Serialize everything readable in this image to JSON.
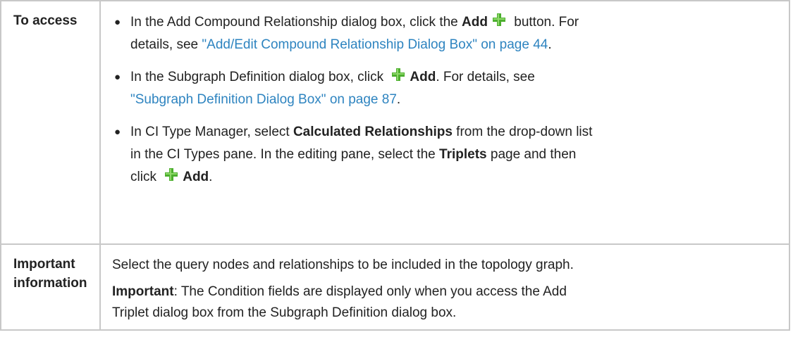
{
  "table": {
    "row1": {
      "header": "To access",
      "items": [
        {
          "line1_pre": "In the Add Compound Relationship dialog box, click the ",
          "line1_bold": "Add",
          "line1_post": " button. For",
          "line2_pre": "details, see ",
          "line2_link": "\"Add/Edit Compound Relationship Dialog Box\" on page 44",
          "line2_post": "."
        },
        {
          "line1_pre": "In the Subgraph Definition dialog box, click ",
          "line1_bold": "Add",
          "line1_post": ". For details, see",
          "line2_link": "\"Subgraph Definition Dialog Box\" on page 87",
          "line2_post": "."
        },
        {
          "line1_pre": "In CI Type Manager, select ",
          "line1_bold": "Calculated Relationships",
          "line1_post": " from the drop-down list",
          "line2_pre": "in the CI Types pane. In the editing pane, select the ",
          "line2_bold": "Triplets",
          "line2_post": " page and then",
          "line3_pre": "click ",
          "line3_bold": "Add",
          "line3_post": "."
        }
      ]
    },
    "row2": {
      "header_line1": "Important",
      "header_line2": "information",
      "p1": "Select the query nodes and relationships to be included in the topology graph.",
      "p2_bold": "Important",
      "p2_line1": ": The Condition fields are displayed only when you access the Add",
      "p2_line2": "Triplet dialog box from the Subgraph Definition dialog box."
    }
  },
  "colors": {
    "link": "#2e84c0",
    "border": "#c8c8c8",
    "icon_green": "#4caf2e"
  }
}
